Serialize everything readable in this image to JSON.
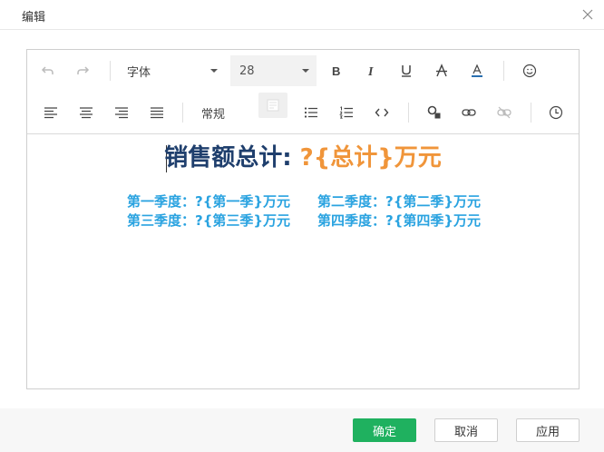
{
  "dialog": {
    "title": "编辑"
  },
  "toolbar": {
    "font_family": "字体",
    "font_size": "28",
    "paragraph": "常规"
  },
  "content": {
    "headline_label": "销售额总计:",
    "headline_value": "?{总计}万元",
    "quarters": [
      [
        "第一季度：?{第一季}万元",
        "第二季度：?{第二季}万元"
      ],
      [
        "第三季度：?{第三季}万元",
        "第四季度：?{第四季}万元"
      ]
    ]
  },
  "footer": {
    "confirm": "确定",
    "cancel": "取消",
    "apply": "应用"
  },
  "colors": {
    "primary": "#1fb15f",
    "headline_label": "#1f3f6d",
    "headline_value": "#f0953a",
    "quarter_text": "#2aa3e0"
  }
}
